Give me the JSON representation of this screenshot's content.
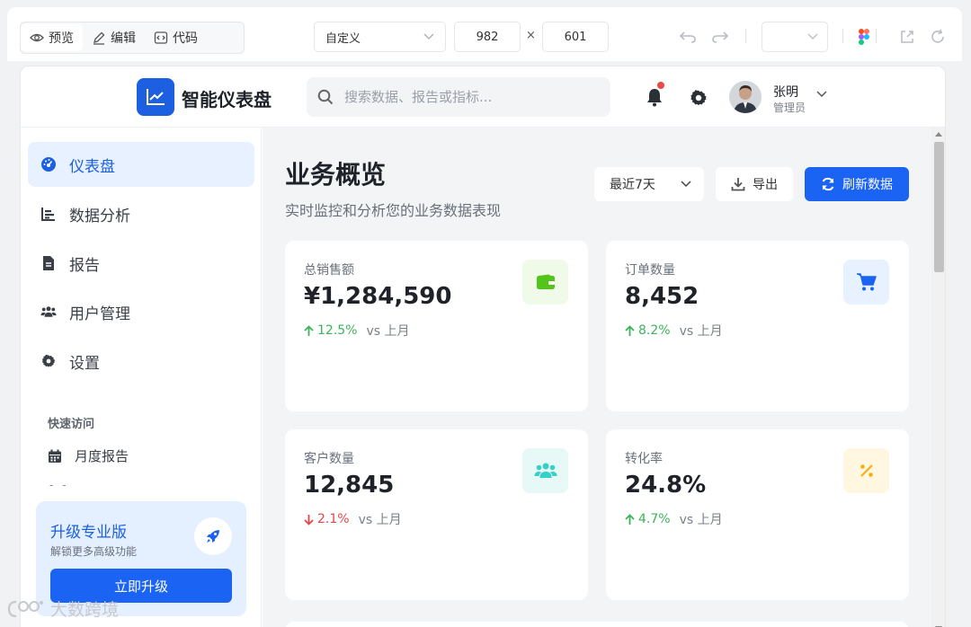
{
  "editor": {
    "tabs": [
      {
        "label": "预览",
        "icon": "eye-icon"
      },
      {
        "label": "编辑",
        "icon": "pencil-icon"
      },
      {
        "label": "代码",
        "icon": "code-icon"
      }
    ],
    "preset": "自定义",
    "width": "982",
    "times": "×",
    "height": "601"
  },
  "header": {
    "logo_text": "智能仪表盘",
    "search_placeholder": "搜索数据、报告或指标...",
    "user_name": "张明",
    "user_role": "管理员"
  },
  "sidebar": {
    "items": [
      {
        "label": "仪表盘",
        "icon": "dashboard-icon",
        "active": true
      },
      {
        "label": "数据分析",
        "icon": "bar-chart-icon"
      },
      {
        "label": "报告",
        "icon": "file-icon"
      },
      {
        "label": "用户管理",
        "icon": "users-icon"
      },
      {
        "label": "设置",
        "icon": "gear-icon"
      }
    ],
    "quick_title": "快速访问",
    "quick_item": "月度报告",
    "quick_dots": "- -",
    "upgrade": {
      "title": "升级专业版",
      "subtitle": "解锁更多高级功能",
      "button": "立即升级"
    }
  },
  "main": {
    "title": "业务概览",
    "subtitle": "实时监控和分析您的业务数据表现",
    "range": "最近7天",
    "export": "导出",
    "refresh": "刷新数据",
    "cards": [
      {
        "label": "总销售额",
        "value": "¥1,284,590",
        "trend": "12.5%",
        "direction": "up",
        "vs": "vs 上月",
        "icon": "wallet-icon",
        "icon_bg": "#f0fae8",
        "icon_color": "#52c41a"
      },
      {
        "label": "订单数量",
        "value": "8,452",
        "trend": "8.2%",
        "direction": "up",
        "vs": "vs 上月",
        "icon": "cart-icon",
        "icon_bg": "#e8f1ff",
        "icon_color": "#1b63f2"
      },
      {
        "label": "客户数量",
        "value": "12,845",
        "trend": "2.1%",
        "direction": "down",
        "vs": "vs 上月",
        "icon": "users-icon",
        "icon_bg": "#e6f9f7",
        "icon_color": "#36cfc9"
      },
      {
        "label": "转化率",
        "value": "24.8%",
        "trend": "4.7%",
        "direction": "up",
        "vs": "vs 上月",
        "icon": "percent-icon",
        "icon_bg": "#fff7e0",
        "icon_color": "#faad14"
      }
    ]
  },
  "colors": {
    "accent": "#1b63f2",
    "up": "#3db35a",
    "down": "#e84545"
  },
  "watermark": "大数跨境"
}
